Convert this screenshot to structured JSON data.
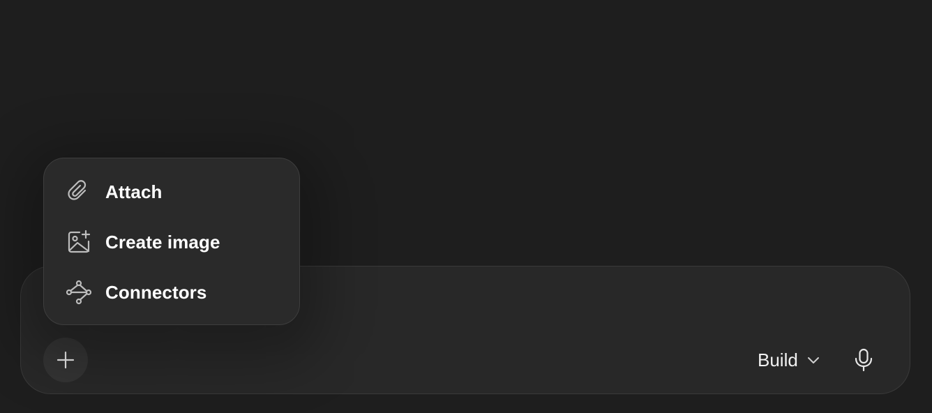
{
  "composer": {
    "input_value": "",
    "input_placeholder": "",
    "add_icon": "plus-icon",
    "mode": {
      "label": "Build",
      "icon": "chevron-down-icon"
    },
    "mic_icon": "microphone-icon"
  },
  "menu": {
    "items": [
      {
        "label": "Attach",
        "icon": "paperclip-icon"
      },
      {
        "label": "Create image",
        "icon": "image-plus-icon"
      },
      {
        "label": "Connectors",
        "icon": "connectors-icon"
      }
    ]
  },
  "colors": {
    "background": "#1e1e1e",
    "composer": "#282828",
    "menu": "#2a2a2a",
    "icon": "#bdbdbd",
    "text": "#ffffff"
  }
}
